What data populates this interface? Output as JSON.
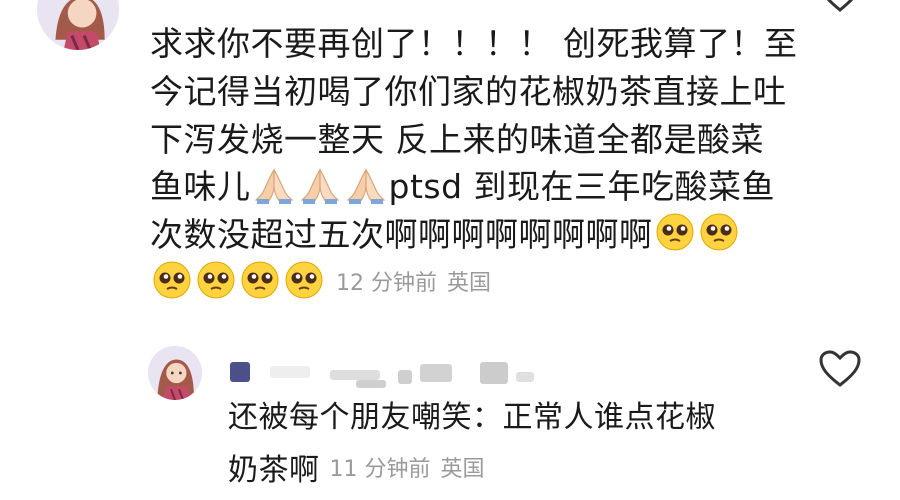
{
  "comment_main": {
    "text_lines": [
      "求求你不要再创了！！！！ 创死我算了！至",
      "今记得当初喝了你们家的花椒奶茶直接上吐",
      "下泻发烧一整天 反上来的味道全都是酸菜",
      "鱼味儿",
      "ptsd 到现在三年吃酸菜鱼",
      "次数没超过五次啊啊啊啊啊啊啊啊"
    ],
    "time": "12 分钟前",
    "location": "英国",
    "emojis": {
      "praying_hands": "praying-hands-icon",
      "pleading_face": "pleading-face-icon"
    }
  },
  "reply": {
    "text_lines": [
      "还被每个朋友嘲笑：正常人谁点花椒",
      "奶茶啊"
    ],
    "time": "11 分钟前",
    "location": "英国"
  },
  "colors": {
    "text": "#1a1a1a",
    "meta": "#9a9a9a",
    "avatar_bg": "#e9e4f2"
  }
}
